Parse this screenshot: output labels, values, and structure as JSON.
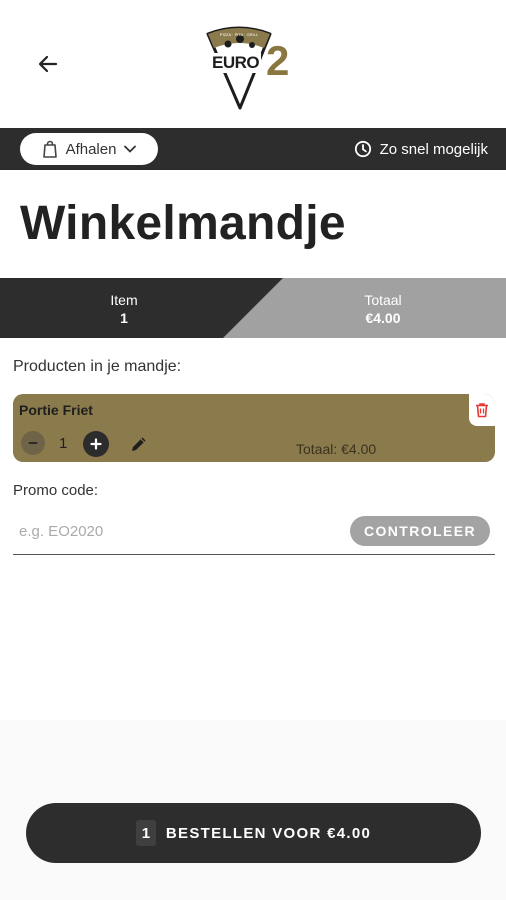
{
  "header": {
    "back_label": "",
    "logo": {
      "top_text": "PIZZA · PITA · GRILL",
      "brand": "EURO",
      "number": "2"
    }
  },
  "service_bar": {
    "pickup_label": "Afhalen",
    "time_label": "Zo snel mogelijk"
  },
  "page_title": "Winkelmandje",
  "summary": {
    "item_label": "Item",
    "item_count": "1",
    "total_label": "Totaal",
    "total_value": "€4.00"
  },
  "cart": {
    "section_label": "Producten in je mandje:",
    "items": [
      {
        "name": "Portie Friet",
        "quantity": "1",
        "total": "Totaal: €4.00"
      }
    ]
  },
  "promo": {
    "label": "Promo code:",
    "placeholder": "e.g. EO2020",
    "value": "",
    "check_label": "CONTROLEER"
  },
  "order_button": {
    "count": "1",
    "label": "BESTELLEN VOOR €4.00"
  },
  "colors": {
    "dark": "#2d2d2d",
    "gold": "#8b7a4c",
    "grey": "#a1a1a1",
    "delete": "#e53935"
  },
  "icons": [
    "arrow-left-icon",
    "shopping-bag-icon",
    "chevron-down-icon",
    "clock-icon",
    "trash-icon",
    "minus-icon",
    "plus-icon",
    "pencil-icon"
  ]
}
